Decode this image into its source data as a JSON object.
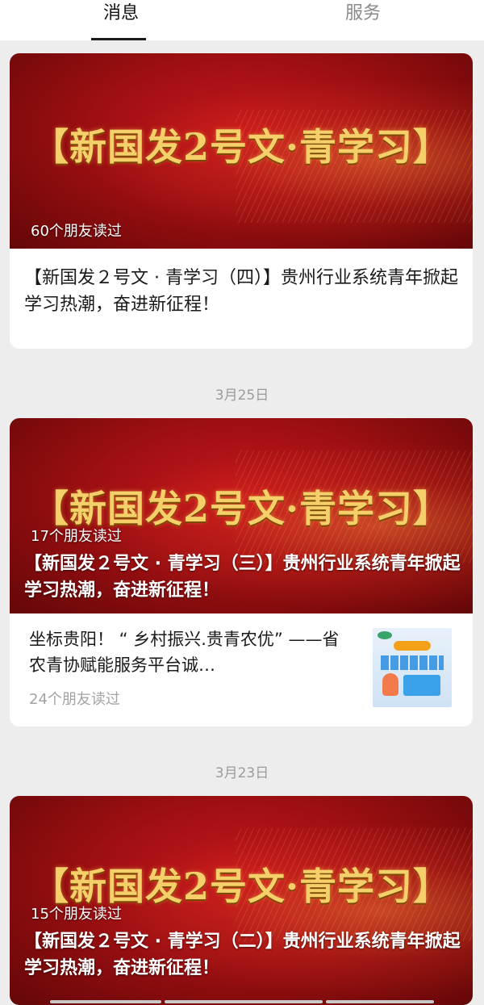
{
  "tabs": [
    {
      "label": "消息"
    },
    {
      "label": "服务"
    }
  ],
  "banner_title": "【新国发2号文·青学习】",
  "articles": [
    {
      "reads": "60个朋友读过",
      "headline": "【新国发２号文 · 青学习（四）】贵州行业系统青年掀起学习热潮，奋进新征程！"
    },
    {
      "date": "3月25日",
      "reads": "17个朋友读过",
      "headline": "【新国发２号文 · 青学习（三）】贵州行业系统青年掀起学习热潮，奋进新征程！",
      "sub": {
        "title": "坐标贵阳！ “ 乡村振兴.贵青农优” ——省农青协赋能服务平台诚…",
        "reads": "24个朋友读过"
      }
    },
    {
      "date": "3月23日",
      "reads": "15个朋友读过",
      "headline": "【新国发２号文 · 青学习（二）】贵州行业系统青年掀起学习热潮，奋进新征程！"
    }
  ]
}
